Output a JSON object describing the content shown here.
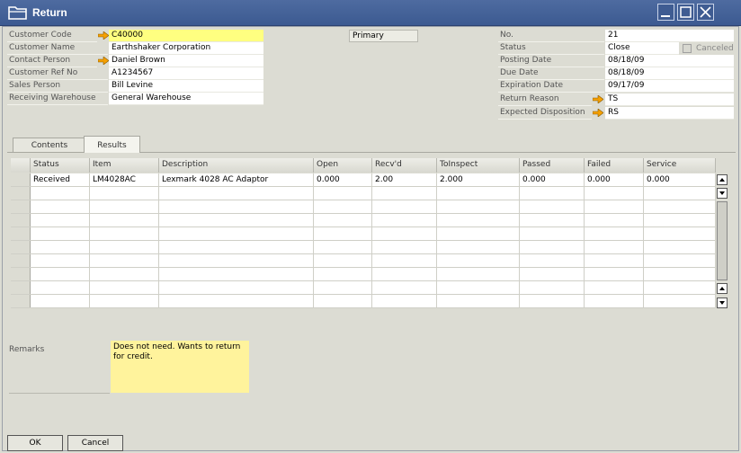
{
  "window": {
    "title": "Return"
  },
  "header_left": [
    {
      "label": "Customer Code",
      "value": "C40000",
      "arrow": true,
      "highlight": true
    },
    {
      "label": "Customer Name",
      "value": "Earthshaker Corporation",
      "arrow": false,
      "highlight": false
    },
    {
      "label": "Contact Person",
      "value": "Daniel Brown",
      "arrow": true,
      "highlight": false
    },
    {
      "label": "Customer Ref No",
      "value": "A1234567",
      "arrow": false,
      "highlight": false
    },
    {
      "label": "Sales Person",
      "value": "Bill Levine",
      "arrow": false,
      "highlight": false
    },
    {
      "label": "Receiving Warehouse",
      "value": "General Warehouse",
      "arrow": false,
      "highlight": false
    }
  ],
  "series_select": "Primary",
  "header_right": [
    {
      "label": "No.",
      "value": "21",
      "arrow": false
    },
    {
      "label": "Status",
      "value": "Close",
      "arrow": false
    },
    {
      "label": "Posting Date",
      "value": "08/18/09",
      "arrow": false
    },
    {
      "label": "Due Date",
      "value": "08/18/09",
      "arrow": false
    },
    {
      "label": "Expiration Date",
      "value": "09/17/09",
      "arrow": false
    },
    {
      "label": "Return Reason",
      "value": "TS",
      "arrow": true
    },
    {
      "label": "Expected Disposition",
      "value": "RS",
      "arrow": true
    }
  ],
  "canceled_label": "Canceled",
  "tabs": [
    {
      "label": "Contents"
    },
    {
      "label": "Results"
    }
  ],
  "grid": {
    "columns": [
      "Status",
      "Item",
      "Description",
      "Open",
      "Recv'd",
      "ToInspect",
      "Passed",
      "Failed",
      "Service"
    ],
    "rows": [
      [
        "Received",
        "LM4028AC",
        "Lexmark 4028 AC Adaptor",
        "0.000",
        "2.00",
        "2.000",
        "0.000",
        "0.000",
        "0.000"
      ]
    ],
    "empty_rows": 9
  },
  "remarks": {
    "label": "Remarks",
    "value": "Does not need.  Wants to return for credit."
  },
  "buttons": {
    "ok": "OK",
    "cancel": "Cancel"
  },
  "colors": {
    "titlebar": "#3c5a91",
    "highlight": "#ffff80",
    "remarks_bg": "#fff39c",
    "arrow": "#f5a000"
  }
}
